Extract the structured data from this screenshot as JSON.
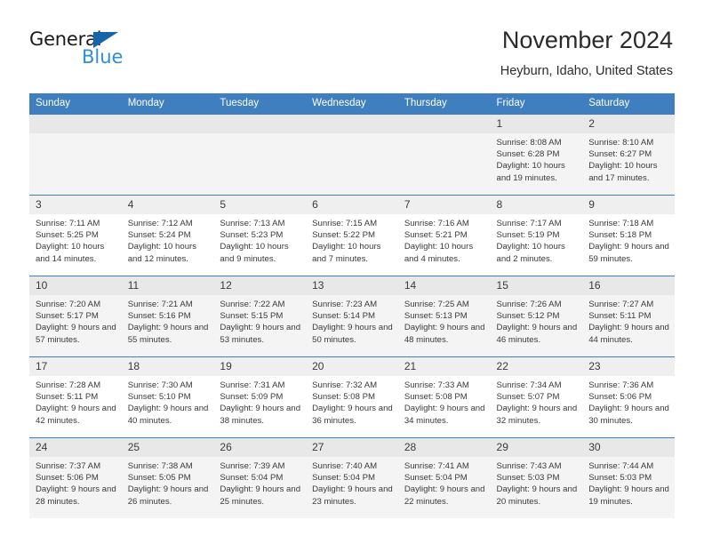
{
  "brand": {
    "line1": "General",
    "line2": "Blue",
    "triangle_color": "#1565a8",
    "blue_text_color": "#2e8fd6"
  },
  "header": {
    "title": "November 2024",
    "location": "Heyburn, Idaho, United States"
  },
  "theme": {
    "header_bg": "#3f7fbf",
    "header_text": "#ffffff",
    "row_shade": "#f4f4f4",
    "daynum_bg": "#efefef"
  },
  "calendar": {
    "weekday_headers": [
      "Sunday",
      "Monday",
      "Tuesday",
      "Wednesday",
      "Thursday",
      "Friday",
      "Saturday"
    ],
    "weeks": [
      [
        {
          "day": "",
          "sunrise": "",
          "sunset": "",
          "daylight": ""
        },
        {
          "day": "",
          "sunrise": "",
          "sunset": "",
          "daylight": ""
        },
        {
          "day": "",
          "sunrise": "",
          "sunset": "",
          "daylight": ""
        },
        {
          "day": "",
          "sunrise": "",
          "sunset": "",
          "daylight": ""
        },
        {
          "day": "",
          "sunrise": "",
          "sunset": "",
          "daylight": ""
        },
        {
          "day": "1",
          "sunrise": "Sunrise: 8:08 AM",
          "sunset": "Sunset: 6:28 PM",
          "daylight": "Daylight: 10 hours and 19 minutes."
        },
        {
          "day": "2",
          "sunrise": "Sunrise: 8:10 AM",
          "sunset": "Sunset: 6:27 PM",
          "daylight": "Daylight: 10 hours and 17 minutes."
        }
      ],
      [
        {
          "day": "3",
          "sunrise": "Sunrise: 7:11 AM",
          "sunset": "Sunset: 5:25 PM",
          "daylight": "Daylight: 10 hours and 14 minutes."
        },
        {
          "day": "4",
          "sunrise": "Sunrise: 7:12 AM",
          "sunset": "Sunset: 5:24 PM",
          "daylight": "Daylight: 10 hours and 12 minutes."
        },
        {
          "day": "5",
          "sunrise": "Sunrise: 7:13 AM",
          "sunset": "Sunset: 5:23 PM",
          "daylight": "Daylight: 10 hours and 9 minutes."
        },
        {
          "day": "6",
          "sunrise": "Sunrise: 7:15 AM",
          "sunset": "Sunset: 5:22 PM",
          "daylight": "Daylight: 10 hours and 7 minutes."
        },
        {
          "day": "7",
          "sunrise": "Sunrise: 7:16 AM",
          "sunset": "Sunset: 5:21 PM",
          "daylight": "Daylight: 10 hours and 4 minutes."
        },
        {
          "day": "8",
          "sunrise": "Sunrise: 7:17 AM",
          "sunset": "Sunset: 5:19 PM",
          "daylight": "Daylight: 10 hours and 2 minutes."
        },
        {
          "day": "9",
          "sunrise": "Sunrise: 7:18 AM",
          "sunset": "Sunset: 5:18 PM",
          "daylight": "Daylight: 9 hours and 59 minutes."
        }
      ],
      [
        {
          "day": "10",
          "sunrise": "Sunrise: 7:20 AM",
          "sunset": "Sunset: 5:17 PM",
          "daylight": "Daylight: 9 hours and 57 minutes."
        },
        {
          "day": "11",
          "sunrise": "Sunrise: 7:21 AM",
          "sunset": "Sunset: 5:16 PM",
          "daylight": "Daylight: 9 hours and 55 minutes."
        },
        {
          "day": "12",
          "sunrise": "Sunrise: 7:22 AM",
          "sunset": "Sunset: 5:15 PM",
          "daylight": "Daylight: 9 hours and 53 minutes."
        },
        {
          "day": "13",
          "sunrise": "Sunrise: 7:23 AM",
          "sunset": "Sunset: 5:14 PM",
          "daylight": "Daylight: 9 hours and 50 minutes."
        },
        {
          "day": "14",
          "sunrise": "Sunrise: 7:25 AM",
          "sunset": "Sunset: 5:13 PM",
          "daylight": "Daylight: 9 hours and 48 minutes."
        },
        {
          "day": "15",
          "sunrise": "Sunrise: 7:26 AM",
          "sunset": "Sunset: 5:12 PM",
          "daylight": "Daylight: 9 hours and 46 minutes."
        },
        {
          "day": "16",
          "sunrise": "Sunrise: 7:27 AM",
          "sunset": "Sunset: 5:11 PM",
          "daylight": "Daylight: 9 hours and 44 minutes."
        }
      ],
      [
        {
          "day": "17",
          "sunrise": "Sunrise: 7:28 AM",
          "sunset": "Sunset: 5:11 PM",
          "daylight": "Daylight: 9 hours and 42 minutes."
        },
        {
          "day": "18",
          "sunrise": "Sunrise: 7:30 AM",
          "sunset": "Sunset: 5:10 PM",
          "daylight": "Daylight: 9 hours and 40 minutes."
        },
        {
          "day": "19",
          "sunrise": "Sunrise: 7:31 AM",
          "sunset": "Sunset: 5:09 PM",
          "daylight": "Daylight: 9 hours and 38 minutes."
        },
        {
          "day": "20",
          "sunrise": "Sunrise: 7:32 AM",
          "sunset": "Sunset: 5:08 PM",
          "daylight": "Daylight: 9 hours and 36 minutes."
        },
        {
          "day": "21",
          "sunrise": "Sunrise: 7:33 AM",
          "sunset": "Sunset: 5:08 PM",
          "daylight": "Daylight: 9 hours and 34 minutes."
        },
        {
          "day": "22",
          "sunrise": "Sunrise: 7:34 AM",
          "sunset": "Sunset: 5:07 PM",
          "daylight": "Daylight: 9 hours and 32 minutes."
        },
        {
          "day": "23",
          "sunrise": "Sunrise: 7:36 AM",
          "sunset": "Sunset: 5:06 PM",
          "daylight": "Daylight: 9 hours and 30 minutes."
        }
      ],
      [
        {
          "day": "24",
          "sunrise": "Sunrise: 7:37 AM",
          "sunset": "Sunset: 5:06 PM",
          "daylight": "Daylight: 9 hours and 28 minutes."
        },
        {
          "day": "25",
          "sunrise": "Sunrise: 7:38 AM",
          "sunset": "Sunset: 5:05 PM",
          "daylight": "Daylight: 9 hours and 26 minutes."
        },
        {
          "day": "26",
          "sunrise": "Sunrise: 7:39 AM",
          "sunset": "Sunset: 5:04 PM",
          "daylight": "Daylight: 9 hours and 25 minutes."
        },
        {
          "day": "27",
          "sunrise": "Sunrise: 7:40 AM",
          "sunset": "Sunset: 5:04 PM",
          "daylight": "Daylight: 9 hours and 23 minutes."
        },
        {
          "day": "28",
          "sunrise": "Sunrise: 7:41 AM",
          "sunset": "Sunset: 5:04 PM",
          "daylight": "Daylight: 9 hours and 22 minutes."
        },
        {
          "day": "29",
          "sunrise": "Sunrise: 7:43 AM",
          "sunset": "Sunset: 5:03 PM",
          "daylight": "Daylight: 9 hours and 20 minutes."
        },
        {
          "day": "30",
          "sunrise": "Sunrise: 7:44 AM",
          "sunset": "Sunset: 5:03 PM",
          "daylight": "Daylight: 9 hours and 19 minutes."
        }
      ]
    ]
  }
}
